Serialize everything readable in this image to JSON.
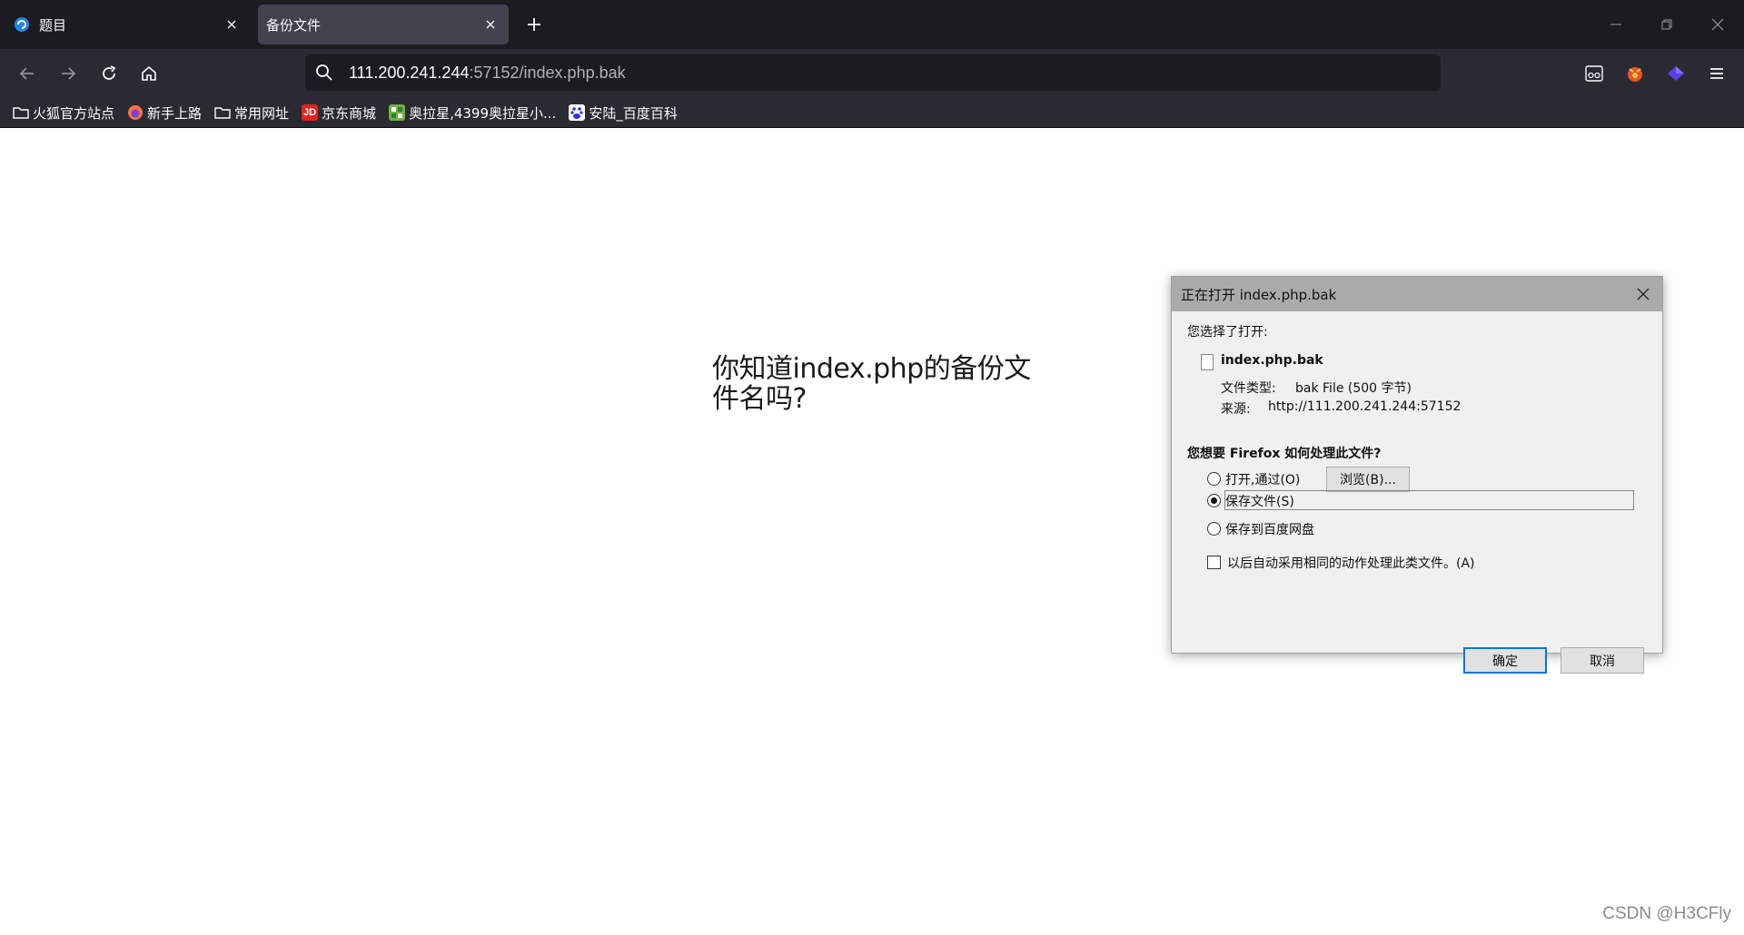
{
  "browser": {
    "tabs": [
      {
        "label": "题目",
        "active": false
      },
      {
        "label": "备份文件",
        "active": true
      }
    ],
    "url": {
      "host": "111.200.241.244",
      "path": ":57152/index.php.bak"
    },
    "bookmarks": [
      {
        "label": "火狐官方站点",
        "icon": "folder-icon"
      },
      {
        "label": "新手上路",
        "icon": "firefox-icon"
      },
      {
        "label": "常用网址",
        "icon": "folder-icon"
      },
      {
        "label": "京东商城",
        "icon": "jd-icon"
      },
      {
        "label": "奥拉星,4399奥拉星小...",
        "icon": "aola-icon"
      },
      {
        "label": "安陆_百度百科",
        "icon": "baidu-icon"
      }
    ]
  },
  "page": {
    "text": "你知道index.php的备份文件名吗?",
    "watermark": "CSDN @H3CFly"
  },
  "dialog": {
    "title": "正在打开 index.php.bak",
    "you_chose": "您选择了打开:",
    "filename": "index.php.bak",
    "filetype_label": "文件类型:",
    "filetype_value": "bak File (500 字节)",
    "source_label": "来源:",
    "source_value": "http://111.200.241.244:57152",
    "question": "您想要 Firefox 如何处理此文件?",
    "option_open": "打开,通过(O)",
    "browse": "浏览(B)...",
    "option_save": "保存文件(S)",
    "option_baidu": "保存到百度网盘",
    "remember": "以后自动采用相同的动作处理此类文件。(A)",
    "ok": "确定",
    "cancel": "取消",
    "selected_option": "save"
  },
  "colors": {
    "tabstrip": "#1c1b22",
    "toolbar": "#2b2a33",
    "active_tab": "#42414d",
    "dialog_title": "#aaaaaa",
    "primary_border": "#0078d7"
  }
}
